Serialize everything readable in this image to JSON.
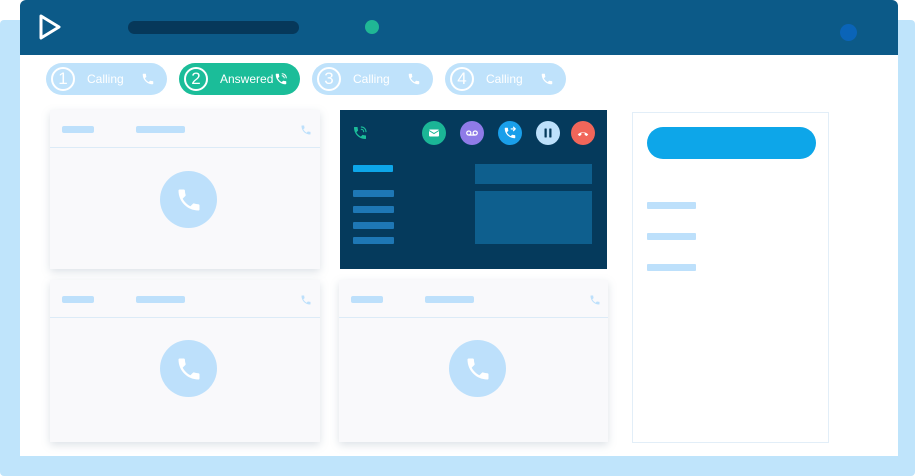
{
  "tabs": [
    {
      "number": "1",
      "label": "Calling",
      "state": "idle"
    },
    {
      "number": "2",
      "label": "Answered",
      "state": "active"
    },
    {
      "number": "3",
      "label": "Calling",
      "state": "idle"
    },
    {
      "number": "4",
      "label": "Calling",
      "state": "idle"
    }
  ],
  "call_controls": [
    {
      "name": "message",
      "icon": "envelope-icon",
      "color": "#1bb596"
    },
    {
      "name": "voicemail",
      "icon": "voicemail-icon",
      "color": "#8f7be8"
    },
    {
      "name": "transfer",
      "icon": "transfer-call-icon",
      "color": "#1a9fea"
    },
    {
      "name": "hold",
      "icon": "pause-icon",
      "color": "#bde0fb"
    },
    {
      "name": "hangup",
      "icon": "hang-up-icon",
      "color": "#f1665a"
    }
  ],
  "colors": {
    "titlebar": "#0c5a88",
    "accent": "#1bbd99",
    "placeholder": "#bde0fb",
    "active_card": "#053a5c",
    "cta": "#0da6e9"
  }
}
